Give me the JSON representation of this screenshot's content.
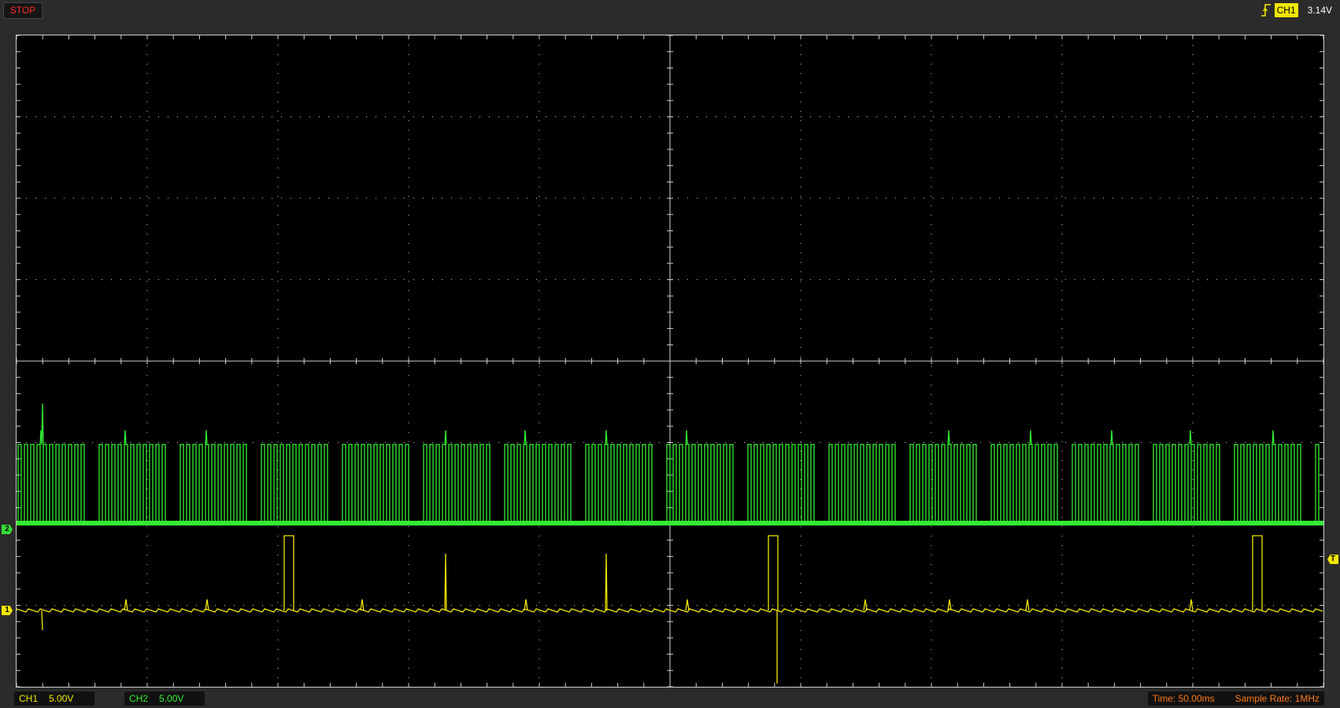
{
  "status": {
    "run_state": "STOP",
    "run_state_color": "#ff2a2a"
  },
  "trigger": {
    "source": "CH1",
    "level": "3.14V",
    "edge": "rising-edge-icon"
  },
  "channels": {
    "ch1": {
      "label": "CH1",
      "coupling": "DC",
      "scale": "5.00V",
      "marker": "1",
      "color": "#f2e600"
    },
    "ch2": {
      "label": "CH2",
      "coupling": "DC",
      "scale": "5.00V",
      "marker": "2",
      "color": "#33ee33"
    }
  },
  "trigger_marker": "T",
  "timebase": {
    "time_label": "Time: 50.00ms",
    "sample_rate_label": "Sample Rate: 1MHz"
  },
  "colors": {
    "grid": "#cfcfcf",
    "background": "#000000",
    "ch1": "#f2e600",
    "ch2": "#33ee33"
  }
}
